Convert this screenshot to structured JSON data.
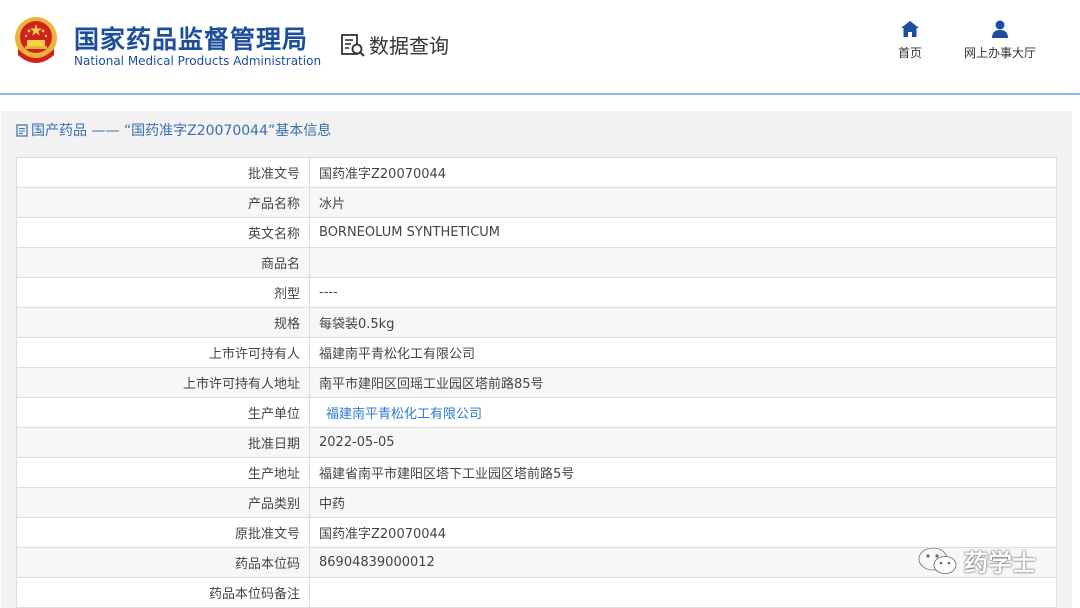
{
  "header": {
    "org_cn": "国家药品监督管理局",
    "org_en": "National Medical Products Administration",
    "data_query": "数据查询",
    "nav": {
      "home": "首页",
      "office": "网上办事大厅"
    }
  },
  "breadcrumb": {
    "text": "国产药品 —— “国药准字Z20070044”基本信息"
  },
  "details": {
    "rows": [
      {
        "label": "批准文号",
        "value": "国药准字Z20070044"
      },
      {
        "label": "产品名称",
        "value": "冰片"
      },
      {
        "label": "英文名称",
        "value": "BORNEOLUM SYNTHETICUM"
      },
      {
        "label": "商品名",
        "value": ""
      },
      {
        "label": "剂型",
        "value": "----"
      },
      {
        "label": "规格",
        "value": "每袋装0.5kg"
      },
      {
        "label": "上市许可持有人",
        "value": "福建南平青松化工有限公司"
      },
      {
        "label": "上市许可持有人地址",
        "value": "南平市建阳区回瑶工业园区塔前路85号"
      },
      {
        "label": "生产单位",
        "value": "福建南平青松化工有限公司"
      },
      {
        "label": "批准日期",
        "value": "2022-05-05"
      },
      {
        "label": "生产地址",
        "value": "福建省南平市建阳区塔下工业园区塔前路5号"
      },
      {
        "label": "产品类别",
        "value": "中药"
      },
      {
        "label": "原批准文号",
        "value": "国药准字Z20070044"
      },
      {
        "label": "药品本位码",
        "value": "86904839000012"
      },
      {
        "label": "药品本位码备注",
        "value": ""
      }
    ]
  },
  "watermark": {
    "text": "药学士"
  },
  "colors": {
    "brand": "#1d4e9e",
    "link": "#2a7bd4",
    "panel": "#f2f2f2",
    "divider": "#8ab8e6"
  }
}
